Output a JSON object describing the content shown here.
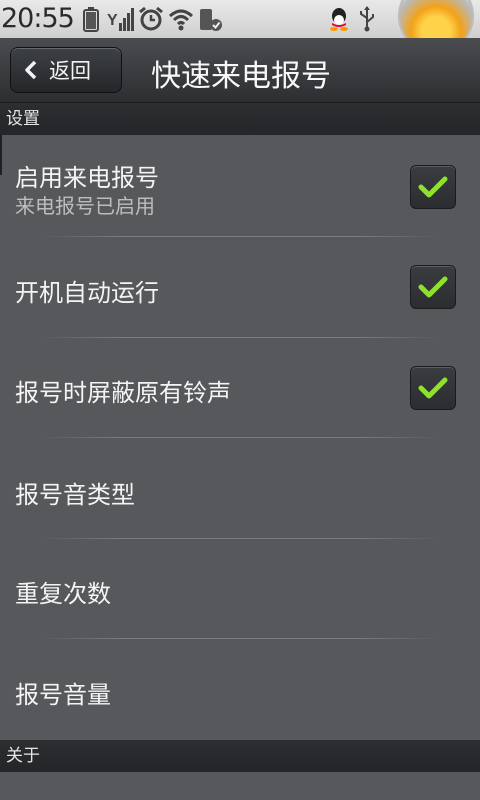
{
  "statusbar": {
    "time": "20:55"
  },
  "header": {
    "back_label": "返回",
    "title": "快速来电报号"
  },
  "sections": {
    "settings": "设置",
    "about": "关于"
  },
  "rows": [
    {
      "label": "启用来电报号",
      "summary": "来电报号已启用",
      "checked": true
    },
    {
      "label": "开机自动运行",
      "checked": true
    },
    {
      "label": "报号时屏蔽原有铃声",
      "checked": true
    },
    {
      "label": "报号音类型"
    },
    {
      "label": "重复次数"
    },
    {
      "label": "报号音量"
    }
  ],
  "colors": {
    "check": "#8fe22b",
    "background": "#56585b",
    "title_bar": "#2c2e31"
  }
}
